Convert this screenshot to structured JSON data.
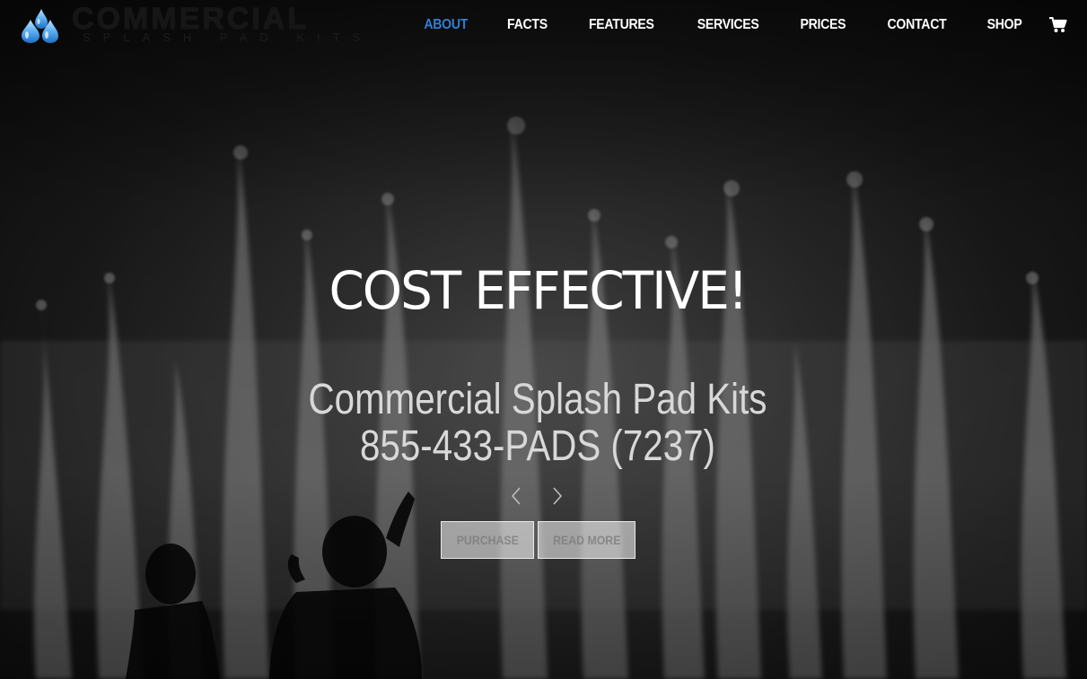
{
  "brand": {
    "title": "COMMERCIAL",
    "subtitle": "SPLASH PAD KITS",
    "drop_color": "#3a8fe0"
  },
  "nav": {
    "items": [
      {
        "label": "ABOUT",
        "active": true
      },
      {
        "label": "FACTS",
        "active": false
      },
      {
        "label": "FEATURES",
        "active": false
      },
      {
        "label": "SERVICES",
        "active": false
      },
      {
        "label": "PRICES",
        "active": false
      },
      {
        "label": "CONTACT",
        "active": false
      },
      {
        "label": "SHOP",
        "active": false
      }
    ],
    "cart_icon": "shopping-cart-icon",
    "active_color": "#2f7fd6"
  },
  "hero": {
    "headline": "COST EFFECTIVE!",
    "subtitle_line1": "Commercial Splash Pad Kits",
    "subtitle_line2": "855-433-PADS (7237)",
    "prev_icon": "chevron-left-icon",
    "next_icon": "chevron-right-icon",
    "buttons": {
      "purchase": "PURCHASE",
      "read_more": "READ MORE"
    }
  }
}
